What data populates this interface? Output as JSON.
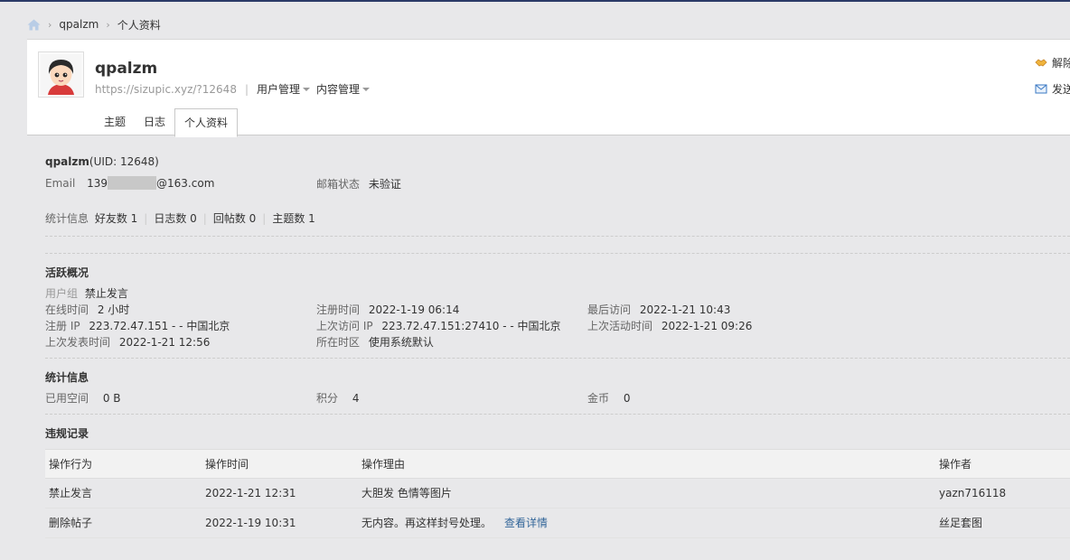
{
  "breadcrumb": {
    "user": "qpalzm",
    "page": "个人资料"
  },
  "header": {
    "username": "qpalzm",
    "url": "https://sizupic.xyz/?12648",
    "menus": [
      "用户管理",
      "内容管理"
    ],
    "tabs": [
      "主题",
      "日志",
      "个人资料"
    ],
    "actions": [
      "解除",
      "发送"
    ]
  },
  "profile": {
    "name": "qpalzm",
    "uid": "(UID: 12648)",
    "email_label": "Email",
    "email_prefix": "139",
    "email_suffix": "@163.com",
    "email_status_label": "邮箱状态",
    "email_status": "未验证",
    "stats_label": "统计信息",
    "stats": [
      "好友数 1",
      "日志数 0",
      "回帖数 0",
      "主题数 1"
    ]
  },
  "activity": {
    "title": "活跃概况",
    "group_label": "用户组",
    "group": "禁止发言",
    "online_label": "在线时间",
    "online": "2 小时",
    "reg_time_label": "注册时间",
    "reg_time": "2022-1-19 06:14",
    "last_visit_label": "最后访问",
    "last_visit": "2022-1-21 10:43",
    "reg_ip_label": "注册 IP",
    "reg_ip": "223.72.47.151 - - 中国北京",
    "last_ip_label": "上次访问 IP",
    "last_ip": "223.72.47.151:27410 - - 中国北京",
    "last_active_label": "上次活动时间",
    "last_active": "2022-1-21 09:26",
    "last_post_label": "上次发表时间",
    "last_post": "2022-1-21 12:56",
    "timezone_label": "所在时区",
    "timezone": "使用系统默认"
  },
  "stats": {
    "title": "统计信息",
    "space_label": "已用空间",
    "space": "0 B",
    "points_label": "积分",
    "points": "4",
    "gold_label": "金币",
    "gold": "0"
  },
  "violations": {
    "title": "违规记录",
    "columns": [
      "操作行为",
      "操作时间",
      "操作理由",
      "操作者"
    ],
    "rows": [
      {
        "action": "禁止发言",
        "time": "2022-1-21 12:31",
        "reason": "大胆发 色情等图片",
        "link": "",
        "operator": "yazn716118"
      },
      {
        "action": "删除帖子",
        "time": "2022-1-19 10:31",
        "reason": "无内容。再这样封号处理。",
        "link": "查看详情",
        "operator": "丝足套图"
      }
    ]
  },
  "colors": {
    "accent": "#336699",
    "topbar": "#2b3a67"
  }
}
